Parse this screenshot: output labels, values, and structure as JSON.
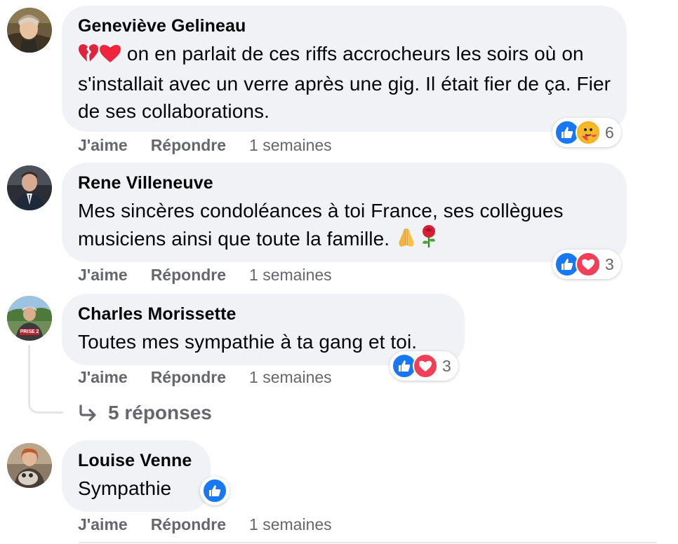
{
  "colors": {
    "like_blue": "#1877f2",
    "love_red": "#f33e58",
    "bubble_bg": "#f0f2f5",
    "meta_gray": "#65676b"
  },
  "comments": [
    {
      "author": "Geneviève Gelineau",
      "text_emojis": [
        "broken-heart-emoji",
        "red-heart-emoji"
      ],
      "text": "on en parlait de ces riffs accrocheurs les soirs où on s'installait avec un verre après une gig. Il était fier de ça. Fier de ses collaborations.",
      "like_label": "J'aime",
      "reply_label": "Répondre",
      "time": "1 semaines",
      "reactions": [
        "like-icon",
        "care-icon"
      ],
      "reaction_count": "6"
    },
    {
      "author": "Rene Villeneuve",
      "text": "Mes sincères condoléances à toi France, ses collègues musiciens ainsi que toute la famille.",
      "text_emojis": [
        "praying-hands-emoji",
        "rose-emoji"
      ],
      "like_label": "J'aime",
      "reply_label": "Répondre",
      "time": "1 semaines",
      "reactions": [
        "like-icon",
        "love-icon"
      ],
      "reaction_count": "3"
    },
    {
      "author": "Charles Morissette",
      "text": "Toutes mes sympathie à ta gang et toi.",
      "avatar_badge": "PRISE 2",
      "like_label": "J'aime",
      "reply_label": "Répondre",
      "time": "1 semaines",
      "reactions": [
        "like-icon",
        "love-icon"
      ],
      "reaction_count": "3",
      "replies_label": "5 réponses"
    },
    {
      "author": "Louise Venne",
      "text": "Sympathie",
      "like_label": "J'aime",
      "reply_label": "Répondre",
      "time": "1 semaines",
      "reactions": [
        "like-icon"
      ]
    }
  ]
}
